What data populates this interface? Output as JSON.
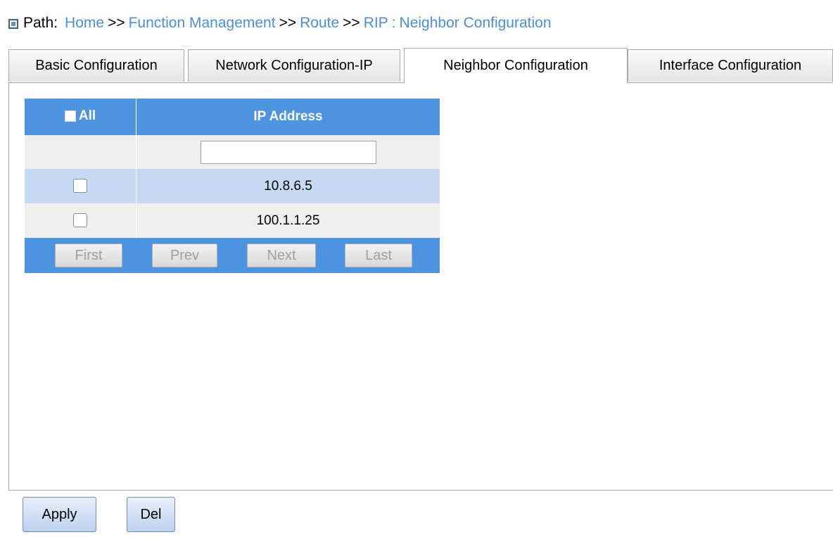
{
  "breadcrumb": {
    "label": "Path:",
    "items": [
      "Home",
      "Function Management",
      "Route",
      "RIP",
      "Neighbor Configuration"
    ],
    "separator": ">>",
    "last_separator": ":"
  },
  "tabs": [
    {
      "label": "Basic Configuration",
      "active": false
    },
    {
      "label": "Network Configuration-IP",
      "active": false
    },
    {
      "label": "Neighbor Configuration",
      "active": true
    },
    {
      "label": "Interface Configuration",
      "active": false
    }
  ],
  "table": {
    "header": {
      "select_all": "All",
      "ip_address": "IP Address"
    },
    "new_ip": {
      "value": "",
      "placeholder": ""
    },
    "rows": [
      {
        "checked": false,
        "ip": "10.8.6.5"
      },
      {
        "checked": false,
        "ip": "100.1.1.25"
      }
    ],
    "pager": {
      "first": "First",
      "prev": "Prev",
      "next": "Next",
      "last": "Last"
    }
  },
  "actions": {
    "apply": "Apply",
    "del": "Del"
  },
  "colors": {
    "header_blue": "#4c94e0",
    "link_blue": "#4a90d8",
    "row_highlight": "#c6d9f3",
    "row_gray": "#efefef"
  }
}
